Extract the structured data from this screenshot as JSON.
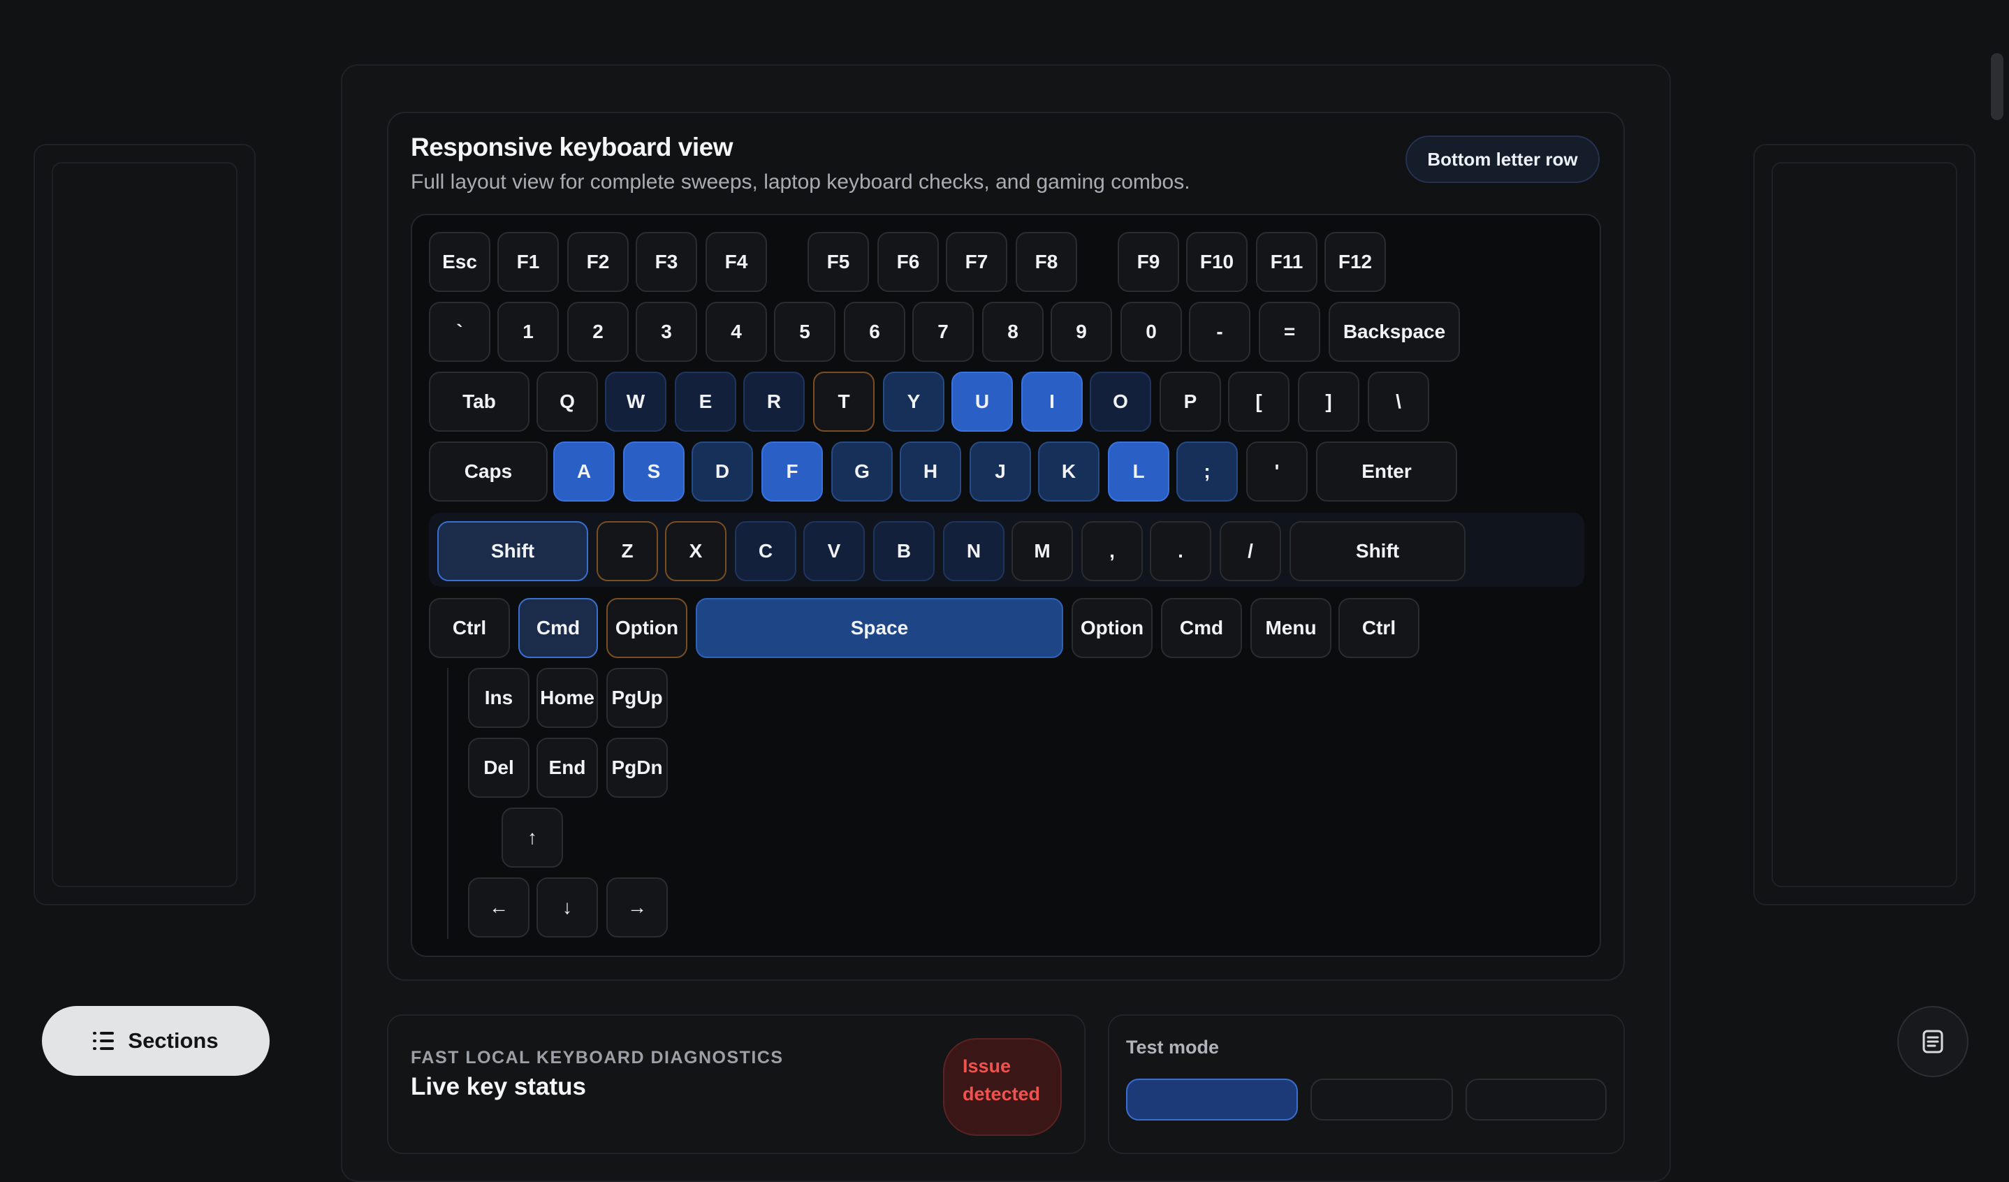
{
  "keyboard": {
    "title": "Responsive keyboard view",
    "subtitle": "Full layout view for complete sweeps, laptop keyboard checks, and gaming combos.",
    "row_badge": "Bottom letter row",
    "keys": {
      "esc": "Esc",
      "f1": "F1",
      "f2": "F2",
      "f3": "F3",
      "f4": "F4",
      "f5": "F5",
      "f6": "F6",
      "f7": "F7",
      "f8": "F8",
      "f9": "F9",
      "f10": "F10",
      "f11": "F11",
      "f12": "F12",
      "backtick": "`",
      "n1": "1",
      "n2": "2",
      "n3": "3",
      "n4": "4",
      "n5": "5",
      "n6": "6",
      "n7": "7",
      "n8": "8",
      "n9": "9",
      "n0": "0",
      "minus": "-",
      "equals": "=",
      "backspace": "Backspace",
      "tab": "Tab",
      "q": "Q",
      "w": "W",
      "e": "E",
      "r": "R",
      "t": "T",
      "y": "Y",
      "u": "U",
      "i": "I",
      "o": "O",
      "p": "P",
      "lbracket": "[",
      "rbracket": "]",
      "backslash": "\\",
      "caps": "Caps",
      "a": "A",
      "s": "S",
      "d": "D",
      "f": "F",
      "g": "G",
      "h": "H",
      "j": "J",
      "k": "K",
      "l": "L",
      "semicolon": ";",
      "quote": "'",
      "enter": "Enter",
      "lshift": "Shift",
      "z": "Z",
      "x": "X",
      "c": "C",
      "v": "V",
      "b": "B",
      "n": "N",
      "m": "M",
      "comma": ",",
      "period": ".",
      "slash": "/",
      "rshift": "Shift",
      "lctrl": "Ctrl",
      "lcmd": "Cmd",
      "loption": "Option",
      "space": "Space",
      "roption": "Option",
      "rcmd": "Cmd",
      "menu": "Menu",
      "rctrl": "Ctrl",
      "ins": "Ins",
      "home": "Home",
      "pgup": "PgUp",
      "del": "Del",
      "end": "End",
      "pgdn": "PgDn",
      "up": "↑",
      "left": "←",
      "down": "↓",
      "right": "→"
    }
  },
  "nav": {
    "sections_label": "Sections"
  },
  "diagnostics": {
    "eyebrow": "FAST LOCAL KEYBOARD DIAGNOSTICS",
    "title": "Live key status",
    "issue_line1": "Issue",
    "issue_line2": "detected"
  },
  "test_mode": {
    "label": "Test mode"
  },
  "colors": {
    "accent_blue": "#2a5fc6",
    "issue_red": "#f0534e",
    "warn_orange": "#7a4e22"
  }
}
